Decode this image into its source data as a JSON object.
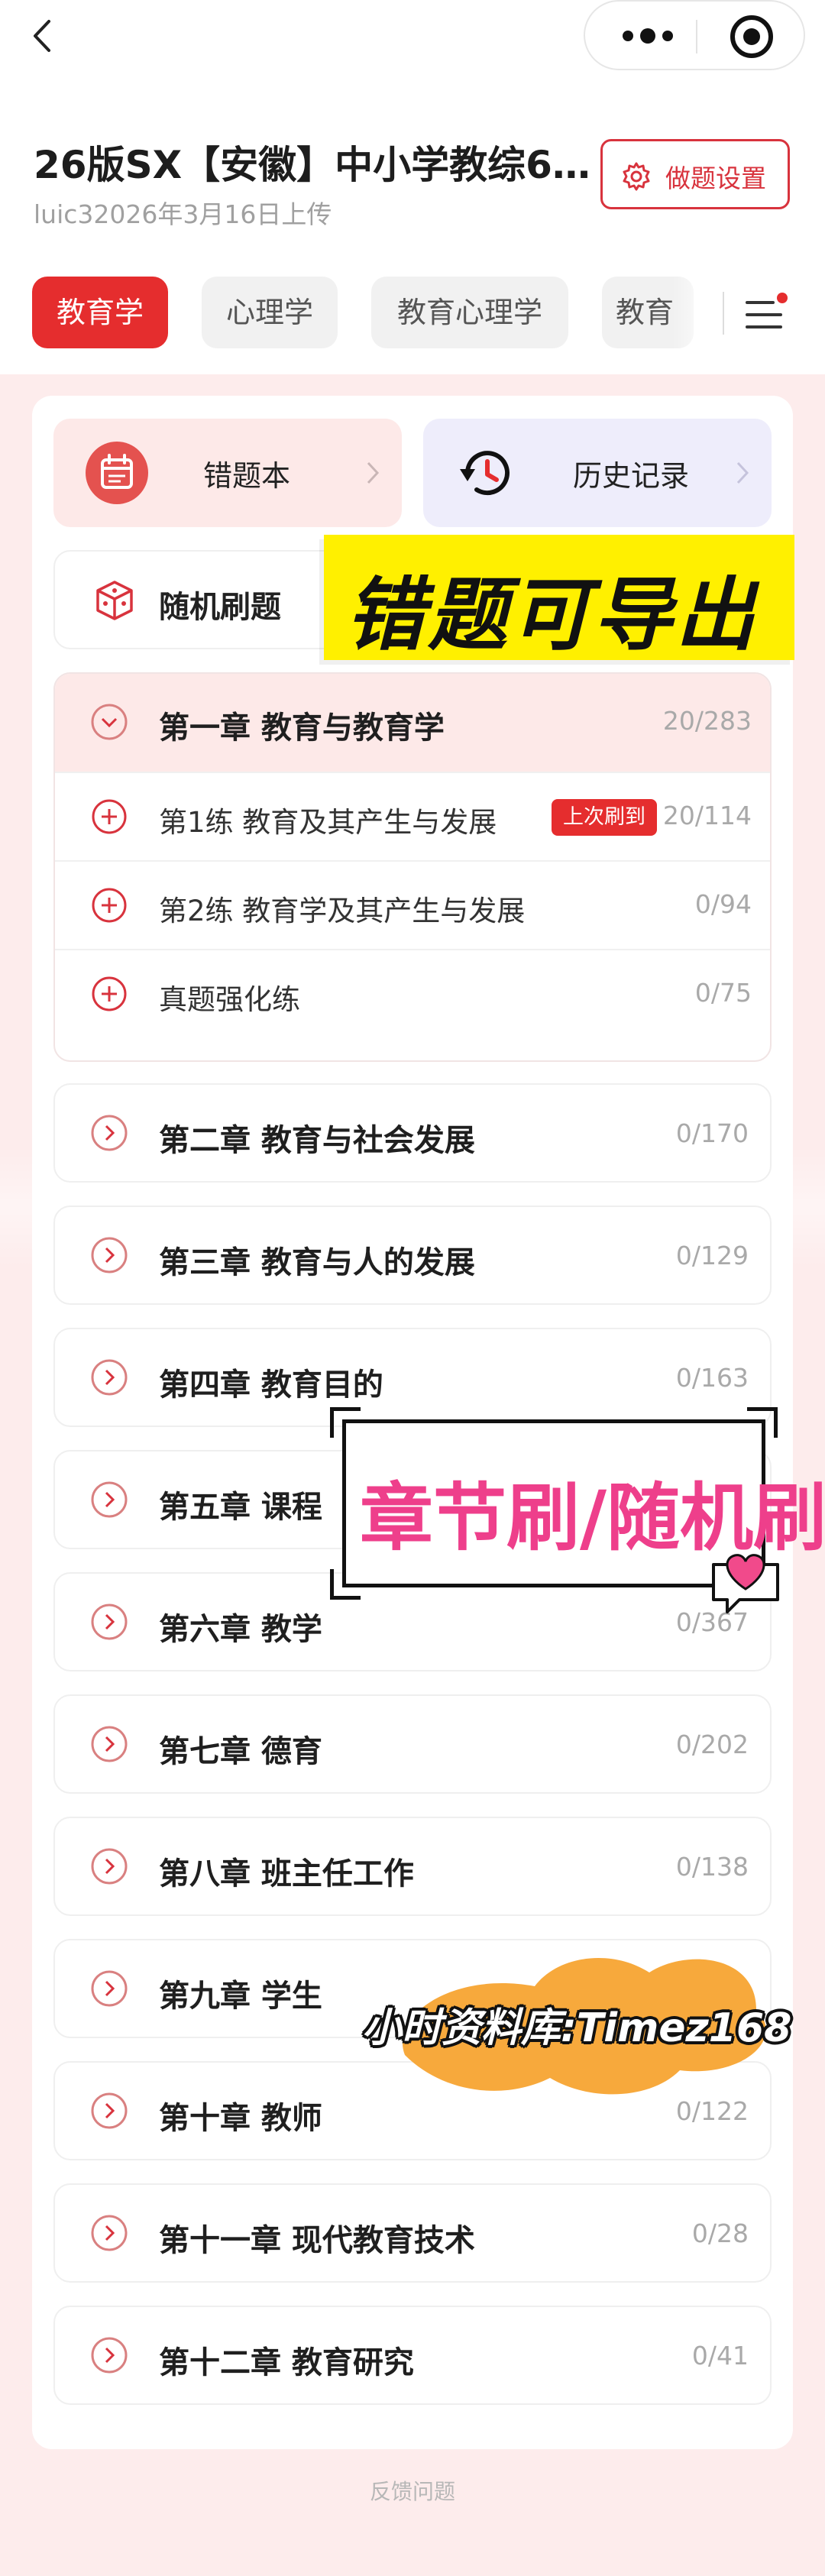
{
  "header": {
    "title": "26版SX【安徽】中小学教综6…",
    "subtitle": "luic32026年3月16日上传",
    "settings_label": "做题设置"
  },
  "tabs": [
    {
      "label": "教育学",
      "active": true
    },
    {
      "label": "心理学",
      "active": false
    },
    {
      "label": "教育心理学",
      "active": false
    },
    {
      "label": "教育",
      "active": false
    }
  ],
  "quick_actions": {
    "wrong_book": "错题本",
    "history": "历史记录"
  },
  "random_label": "随机刷题",
  "overlays": {
    "export_banner": "错题可导出",
    "chapter_banner": "章节刷/随机刷",
    "watermark": "小时资料库:Timez168"
  },
  "chapter_one": {
    "title": "第一章 教育与教育学",
    "count": "20/283",
    "sections": [
      {
        "title": "第1练 教育及其产生与发展",
        "count": "20/114",
        "badge": "上次刷到"
      },
      {
        "title": "第2练 教育学及其产生与发展",
        "count": "0/94"
      },
      {
        "title": "真题强化练",
        "count": "0/75"
      }
    ]
  },
  "chapters": [
    {
      "title": "第二章 教育与社会发展",
      "count": "0/170"
    },
    {
      "title": "第三章 教育与人的发展",
      "count": "0/129"
    },
    {
      "title": "第四章 教育目的",
      "count": "0/163"
    },
    {
      "title": "第五章 课程",
      "count": ""
    },
    {
      "title": "第六章 教学",
      "count": "0/367"
    },
    {
      "title": "第七章 德育",
      "count": "0/202"
    },
    {
      "title": "第八章 班主任工作",
      "count": "0/138"
    },
    {
      "title": "第九章 学生",
      "count": ""
    },
    {
      "title": "第十章 教师",
      "count": "0/122"
    },
    {
      "title": "第十一章 现代教育技术",
      "count": "0/28"
    },
    {
      "title": "第十二章 教育研究",
      "count": "0/41"
    }
  ],
  "footer": {
    "feedback": "反馈问题"
  },
  "colors": {
    "accent": "#e52d2e",
    "page_bg": "#fdecec",
    "banner_yellow": "#fff000",
    "banner_pink": "#ee3f8b"
  }
}
